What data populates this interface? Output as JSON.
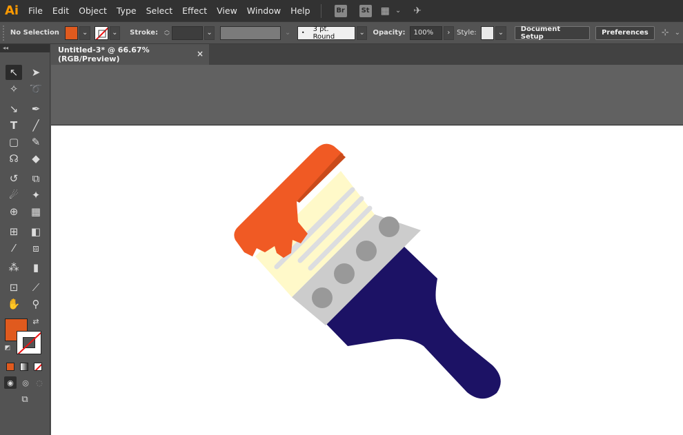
{
  "app": {
    "logo": "Ai"
  },
  "menu": [
    "File",
    "Edit",
    "Object",
    "Type",
    "Select",
    "Effect",
    "View",
    "Window",
    "Help"
  ],
  "menubar_icons": {
    "bridge": "Br",
    "stock": "St"
  },
  "control": {
    "selection": "No Selection",
    "stroke_label": "Stroke:",
    "brush_value": "3 pt. Round",
    "opacity_label": "Opacity:",
    "opacity_value": "100%",
    "style_label": "Style:",
    "doc_setup": "Document Setup",
    "preferences": "Preferences"
  },
  "document": {
    "tab_title": "Untitled-3* @ 66.67% (RGB/Preview)",
    "close": "×"
  },
  "colors": {
    "fill": "#e05a1e",
    "brush_tip": "#f05a24",
    "bristles": "#fff9c9",
    "bristle_lines": "#dcdde0",
    "ferrule": "#cccccc",
    "ferrule_dots": "#999999",
    "handle": "#1c1265"
  },
  "panel_grip": "◂◂"
}
